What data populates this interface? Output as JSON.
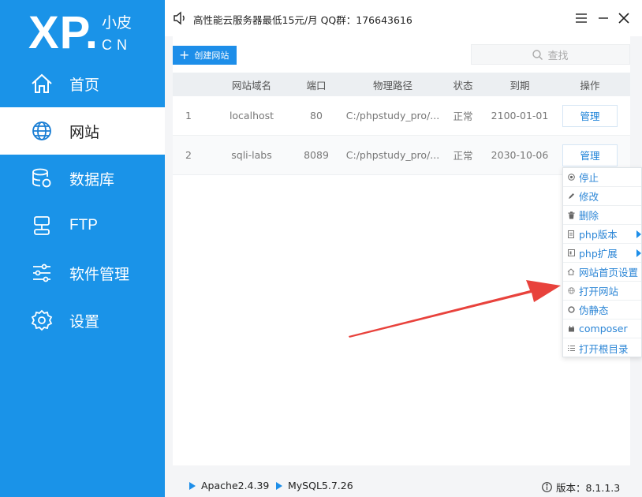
{
  "logo": {
    "main": "XP.",
    "line1": "小皮",
    "line2": "CN"
  },
  "nav": {
    "items": [
      {
        "label": "首页",
        "icon": "home-icon"
      },
      {
        "label": "网站",
        "icon": "globe-icon"
      },
      {
        "label": "数据库",
        "icon": "database-icon"
      },
      {
        "label": "FTP",
        "icon": "ftp-server-icon"
      },
      {
        "label": "软件管理",
        "icon": "sliders-icon"
      },
      {
        "label": "设置",
        "icon": "gear-icon"
      }
    ],
    "active": "网站"
  },
  "titlebar": {
    "notice": "高性能云服务器最低15元/月 QQ群：176643616"
  },
  "toolbar": {
    "create_label": "创建网站",
    "search_placeholder": "查找"
  },
  "table": {
    "headers": [
      "网站域名",
      "端口",
      "物理路径",
      "状态",
      "到期",
      "操作"
    ],
    "rows": [
      {
        "index": "1",
        "domain": "localhost",
        "port": "80",
        "path": "C:/phpstudy_pro/...",
        "status": "正常",
        "expire": "2100-01-01",
        "action": "管理"
      },
      {
        "index": "2",
        "domain": "sqli-labs",
        "port": "8089",
        "path": "C:/phpstudy_pro/...",
        "status": "正常",
        "expire": "2030-10-06",
        "action": "管理"
      }
    ]
  },
  "context_menu": {
    "items": [
      {
        "label": "停止",
        "icon": "stop-icon",
        "submenu": false
      },
      {
        "label": "修改",
        "icon": "pencil-icon",
        "submenu": false
      },
      {
        "label": "删除",
        "icon": "trash-icon",
        "submenu": false
      },
      {
        "label": "php版本",
        "icon": "document-icon",
        "submenu": true
      },
      {
        "label": "php扩展",
        "icon": "extension-icon",
        "submenu": true
      },
      {
        "label": "网站首页设置",
        "icon": "homepage-icon",
        "submenu": false
      },
      {
        "label": "打开网站",
        "icon": "globe-small-icon",
        "submenu": false
      },
      {
        "label": "伪静态",
        "icon": "rewrite-icon",
        "submenu": false
      },
      {
        "label": "composer",
        "icon": "composer-icon",
        "submenu": false
      },
      {
        "label": "打开根目录",
        "icon": "list-icon",
        "submenu": false
      }
    ]
  },
  "statusbar": {
    "apache": "Apache2.4.39",
    "mysql": "MySQL5.7.26",
    "version": "版本：8.1.1.3"
  },
  "colors": {
    "accent": "#1a93e8",
    "link": "#2c86d6",
    "annotation_arrow": "#e8423c"
  }
}
